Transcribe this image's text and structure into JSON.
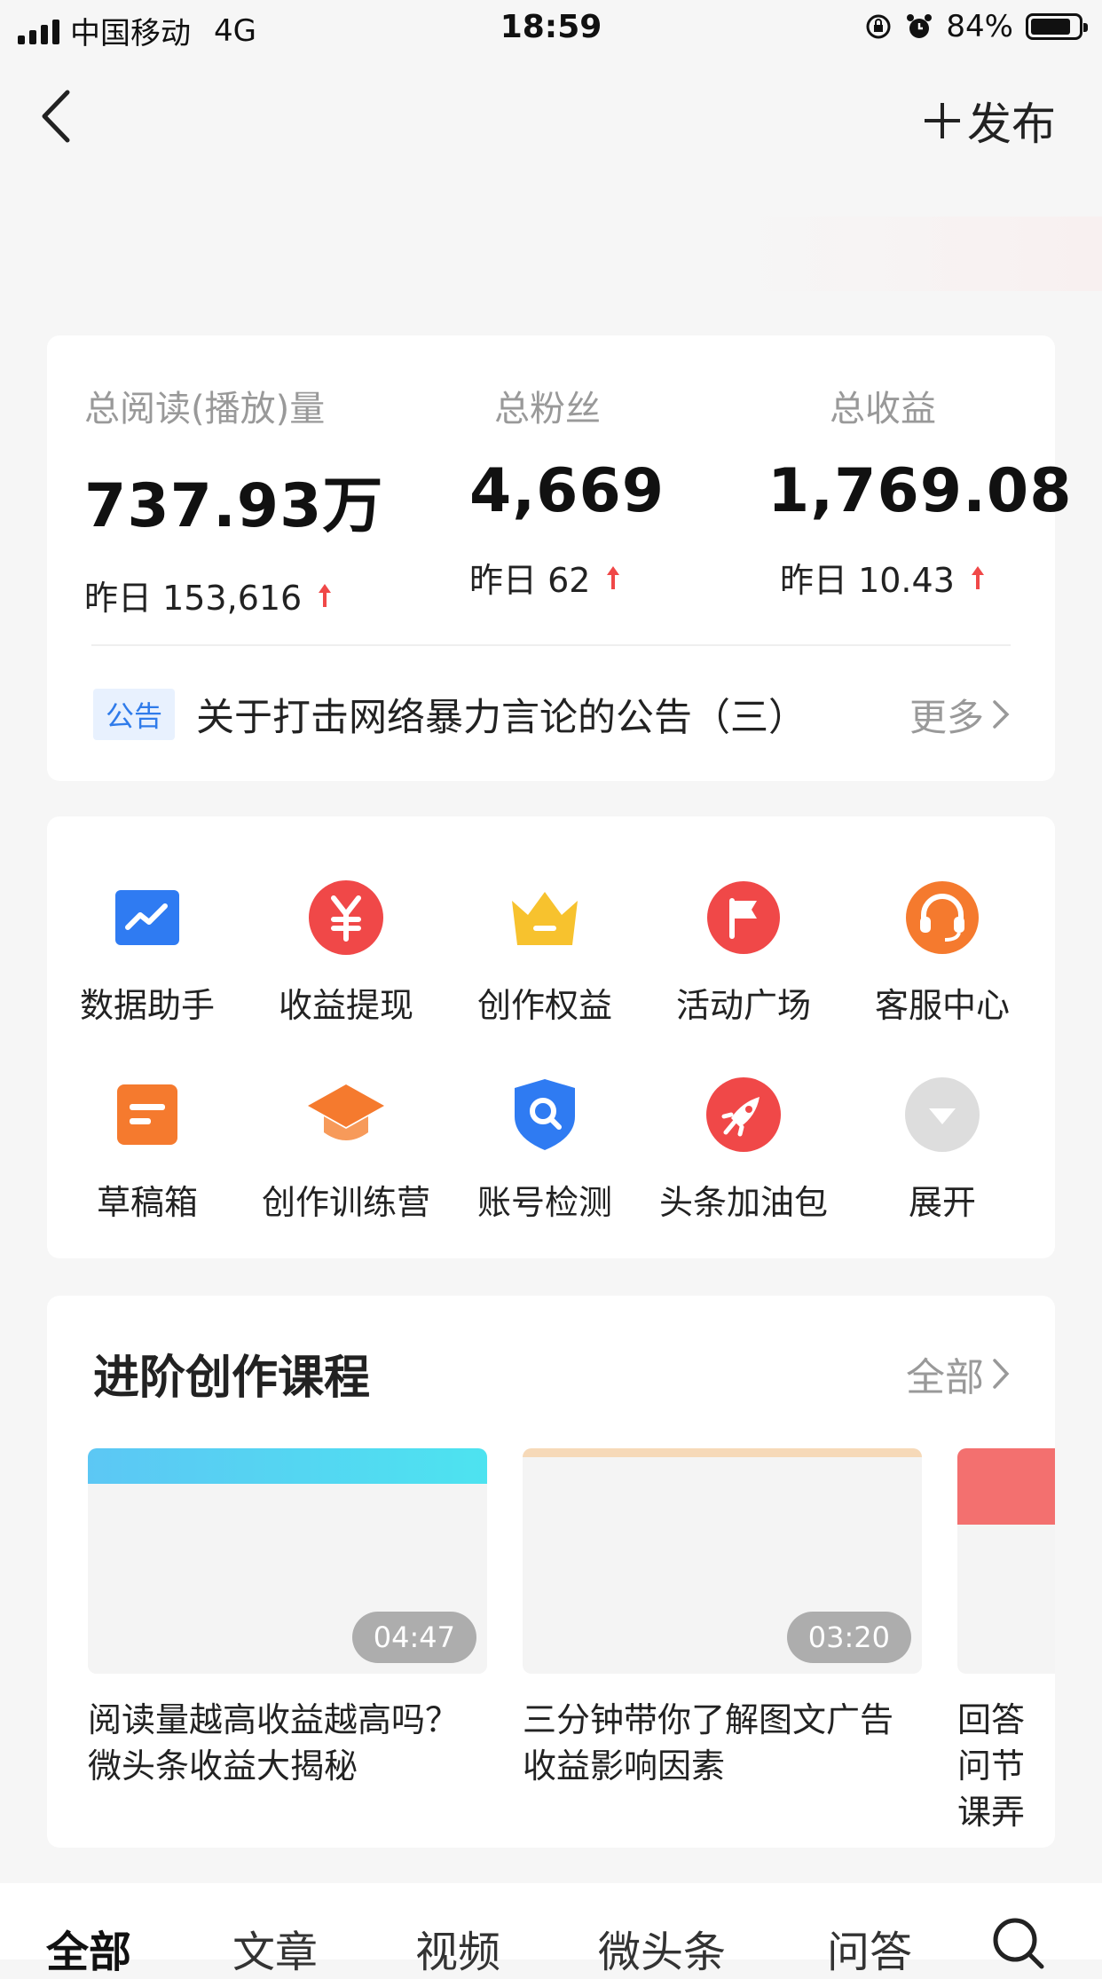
{
  "status_bar": {
    "carrier": "中国移动",
    "network": "4G",
    "time": "18:59",
    "battery": "84%",
    "battery_level": 0.84
  },
  "nav": {
    "publish_label": "发布"
  },
  "stats": [
    {
      "label": "总阅读(播放)量",
      "value": "737.93万",
      "yesterday": "昨日 153,616"
    },
    {
      "label": "总粉丝",
      "value": "4,669",
      "yesterday": "昨日 62"
    },
    {
      "label": "总收益",
      "value": "1,769.08",
      "yesterday": "昨日 10.43"
    }
  ],
  "notice": {
    "tag": "公告",
    "text": "关于打击网络暴力言论的公告（三）",
    "more": "更多"
  },
  "tools": [
    {
      "label": "数据助手",
      "icon": "chart-trend-icon",
      "color": "#2f7bf2"
    },
    {
      "label": "收益提现",
      "icon": "yen-icon",
      "color": "#f04848"
    },
    {
      "label": "创作权益",
      "icon": "crown-icon",
      "color": "#f7c22e"
    },
    {
      "label": "活动广场",
      "icon": "flag-icon",
      "color": "#f04848"
    },
    {
      "label": "客服中心",
      "icon": "headset-icon",
      "color": "#f57a2e"
    },
    {
      "label": "草稿箱",
      "icon": "draft-icon",
      "color": "#f57a2e"
    },
    {
      "label": "创作训练营",
      "icon": "graduation-cap-icon",
      "color": "#f57a2e"
    },
    {
      "label": "账号检测",
      "icon": "shield-search-icon",
      "color": "#2f7bf2"
    },
    {
      "label": "头条加油包",
      "icon": "rocket-icon",
      "color": "#f04848"
    },
    {
      "label": "展开",
      "icon": "expand-down-icon",
      "color": "#dddddd"
    }
  ],
  "courses": {
    "title": "进阶创作课程",
    "all_label": "全部",
    "items": [
      {
        "title": "阅读量越高收益越高吗？微头条收益大揭秘",
        "duration": "04:47"
      },
      {
        "title": "三分钟带你了解图文广告收益影响因素",
        "duration": "03:20"
      },
      {
        "title": "回答问节课弄",
        "duration": ""
      }
    ]
  },
  "bottom_tabs": [
    {
      "label": "全部",
      "active": true
    },
    {
      "label": "文章",
      "active": false
    },
    {
      "label": "视频",
      "active": false
    },
    {
      "label": "微头条",
      "active": false
    },
    {
      "label": "问答",
      "active": false
    }
  ]
}
